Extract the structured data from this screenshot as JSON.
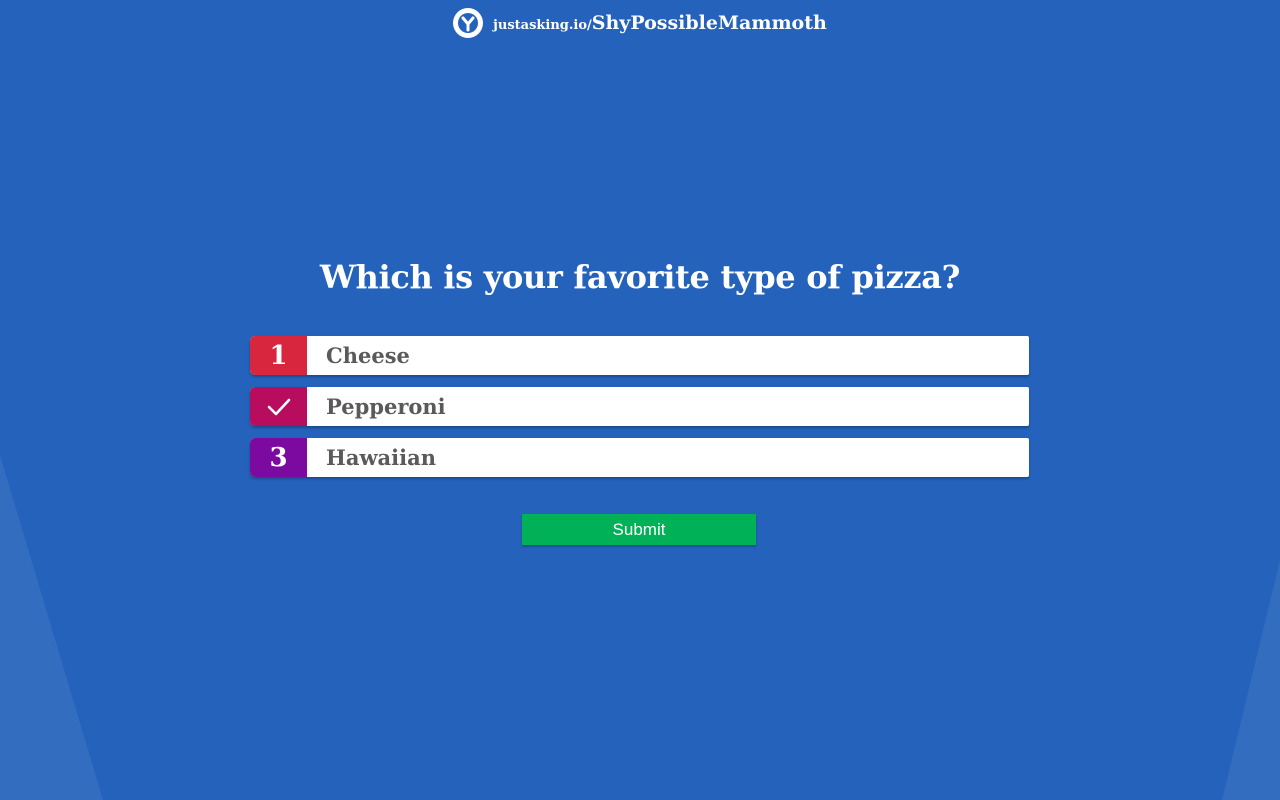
{
  "header": {
    "domain": "justasking.io/",
    "code": "ShyPossibleMammoth",
    "logo_icon": "justasking-logo-icon"
  },
  "question": "Which is your favorite type of pizza?",
  "options": [
    {
      "badge": "1",
      "label": "Cheese",
      "color": "#d7263d",
      "selected": false
    },
    {
      "badge": "",
      "label": "Pepperoni",
      "color": "#b80c5e",
      "selected": true,
      "icon": "check-icon"
    },
    {
      "badge": "3",
      "label": "Hawaiian",
      "color": "#7d0aa0",
      "selected": false
    }
  ],
  "submit_label": "Submit",
  "colors": {
    "background": "#2462bb",
    "submit": "#00b158"
  }
}
